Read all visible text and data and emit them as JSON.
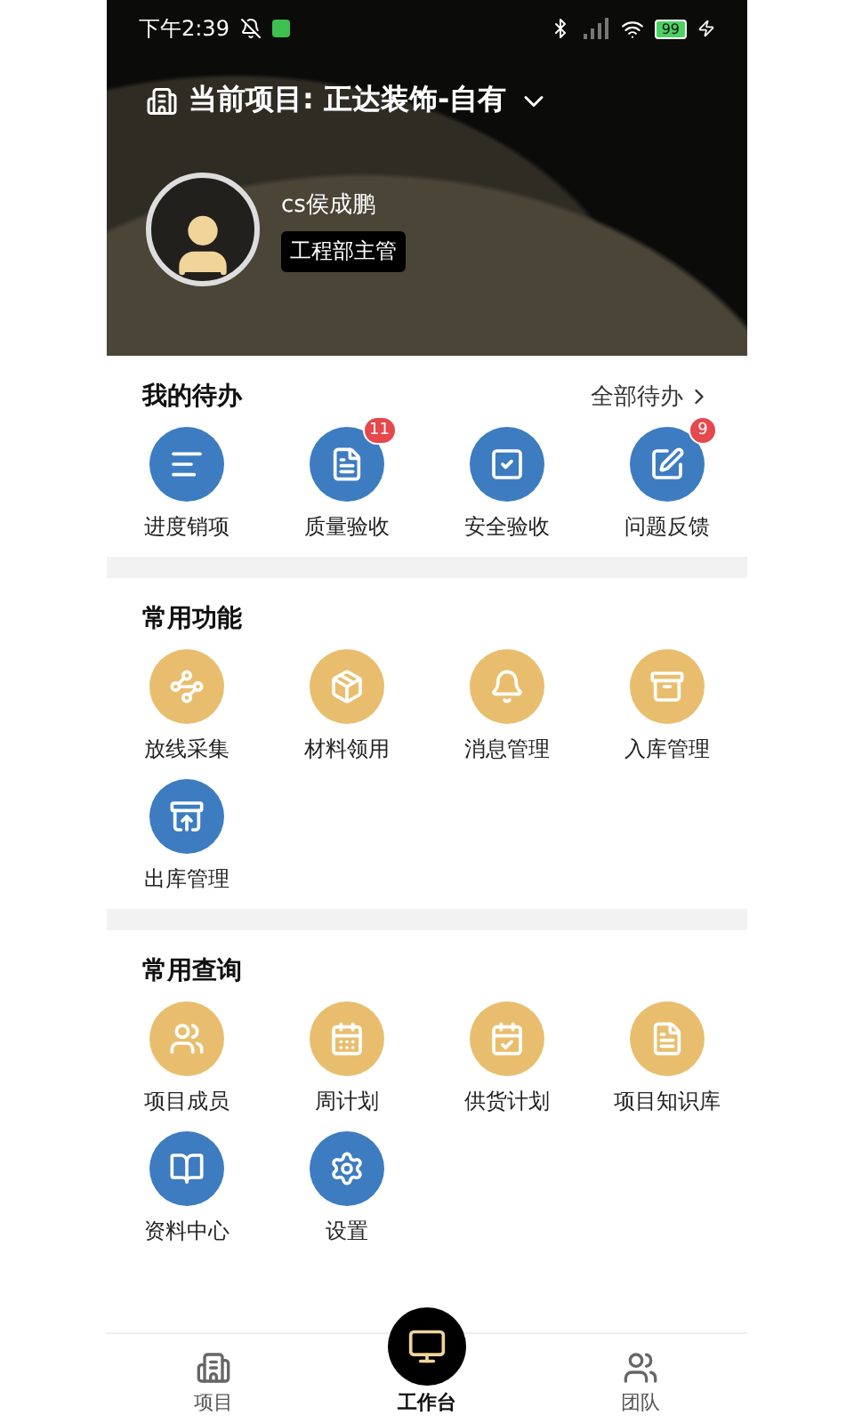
{
  "status_bar": {
    "time": "下午2:39",
    "battery": "99"
  },
  "header": {
    "project_label": "当前项目: 正达装饰-自有",
    "user_name": "cs侯成鹏",
    "role": "工程部主管"
  },
  "todo": {
    "title": "我的待办",
    "more": "全部待办",
    "items": [
      {
        "label": "进度销项",
        "color": "#3d7cc0"
      },
      {
        "label": "质量验收",
        "color": "#3d7cc0",
        "badge": "11"
      },
      {
        "label": "安全验收",
        "color": "#3d7cc0"
      },
      {
        "label": "问题反馈",
        "color": "#3d7cc0",
        "badge": "9"
      }
    ]
  },
  "functions": {
    "title": "常用功能",
    "items": [
      {
        "label": "放线采集",
        "color": "#e8be6e"
      },
      {
        "label": "材料领用",
        "color": "#e8be6e"
      },
      {
        "label": "消息管理",
        "color": "#e8be6e"
      },
      {
        "label": "入库管理",
        "color": "#e8be6e"
      },
      {
        "label": "出库管理",
        "color": "#3d7cc0"
      }
    ]
  },
  "queries": {
    "title": "常用查询",
    "items": [
      {
        "label": "项目成员",
        "color": "#e8be6e"
      },
      {
        "label": "周计划",
        "color": "#e8be6e"
      },
      {
        "label": "供货计划",
        "color": "#e8be6e"
      },
      {
        "label": "项目知识库",
        "color": "#e8be6e"
      },
      {
        "label": "资料中心",
        "color": "#3d7cc0"
      },
      {
        "label": "设置",
        "color": "#3d7cc0"
      }
    ]
  },
  "tab_bar": [
    {
      "label": "项目",
      "selected": false
    },
    {
      "label": "工作台",
      "selected": true
    },
    {
      "label": "团队",
      "selected": false
    }
  ]
}
